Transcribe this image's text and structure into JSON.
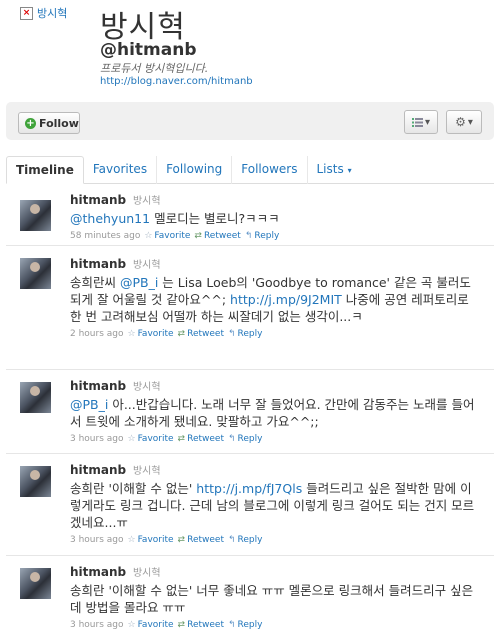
{
  "profile": {
    "avatar_alt": "방시혁",
    "display_name": "방시혁",
    "screen_name": "@hitmanb",
    "bio": "프로듀서 방시혁입니다.",
    "url": "http://blog.naver.com/hitmanb"
  },
  "actions": {
    "follow_label": "Follow",
    "list_icon": "list-icon",
    "gear_icon": "gear-icon"
  },
  "tabs": [
    {
      "label": "Timeline",
      "active": true
    },
    {
      "label": "Favorites"
    },
    {
      "label": "Following"
    },
    {
      "label": "Followers"
    },
    {
      "label": "Lists"
    }
  ],
  "tweet_actions": {
    "favorite": "Favorite",
    "retweet": "Retweet",
    "reply": "Reply"
  },
  "tweets": [
    {
      "user": "hitmanb",
      "realname": "방시혁",
      "mention": "@thehyun11",
      "text": " 멜로디는 별로니?ㅋㅋㅋ",
      "time": "58 minutes ago"
    },
    {
      "user": "hitmanb",
      "realname": "방시혁",
      "pre": "송희란씨 ",
      "mention": "@PB_i",
      "mid": " 는 Lisa Loeb의 'Goodbye to romance' 같은 곡 불러도 되게 잘 어울릴 것 같아요^^; ",
      "link": "http://j.mp/9J2MIT",
      "post": " 나중에 공연 레퍼토리로 한 번 고려해보심 어떨까 하는 씨잘데기 없는 생각이...ㅋ",
      "time": "2 hours ago"
    },
    {
      "user": "hitmanb",
      "realname": "방시혁",
      "mention": "@PB_i",
      "text": " 아...반갑습니다. 노래 너무 잘 들었어요. 간만에 감동주는 노래를 들어서 트윗에 소개하게 됐네요. 맞팔하고 가요^^;;",
      "time": "3 hours ago"
    },
    {
      "user": "hitmanb",
      "realname": "방시혁",
      "pre": "송희란 '이해할 수 없는' ",
      "link": "http://j.mp/fJ7Qls",
      "post": " 들려드리고 싶은 절박한 맘에 이렇게라도 링크 겁니다. 근데 남의 블로그에 이렇게 링크 걸어도 되는 건지 모르겠네요...ㅠ",
      "time": "3 hours ago"
    },
    {
      "user": "hitmanb",
      "realname": "방시혁",
      "text": "송희란 '이해할 수 없는' 너무 좋네요 ㅠㅠ 멜론으로 링크해서 들려드리구 싶은데 방법을 몰라요 ㅠㅠ",
      "time": "3 hours ago"
    }
  ]
}
